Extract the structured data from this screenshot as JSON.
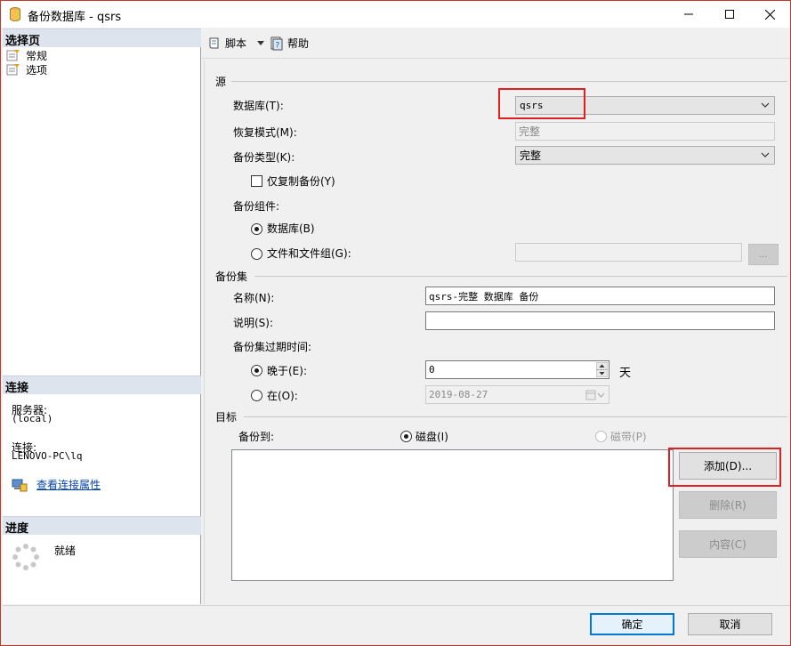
{
  "window": {
    "title": "备份数据库 - qsrs",
    "icon": "database-cylinder-icon",
    "accent_border": "#c0392b"
  },
  "left": {
    "select_page_header": "选择页",
    "pages": [
      {
        "label": "常规",
        "icon": "page-icon"
      },
      {
        "label": "选项",
        "icon": "page-icon"
      }
    ],
    "connection_header": "连接",
    "server_label": "服务器:",
    "server_value": "(local)",
    "connection_label": "连接:",
    "connection_value": "LENOVO-PC\\lq",
    "view_conn_props": "查看连接属性",
    "progress_header": "进度",
    "progress_status": "就绪"
  },
  "toolbar": {
    "script_label": "脚本",
    "help_label": "帮助"
  },
  "source": {
    "group_title": "源",
    "database_label": "数据库(T):",
    "database_value": "qsrs",
    "recovery_label": "恢复模式(M):",
    "recovery_value": "完整",
    "backup_type_label": "备份类型(K):",
    "backup_type_value": "完整",
    "copy_only_label": "仅复制备份(Y)",
    "component_label": "备份组件:",
    "component_db_label": "数据库(B)",
    "component_files_label": "文件和文件组(G):",
    "browse_label": "..."
  },
  "backup_set": {
    "group_title": "备份集",
    "name_label": "名称(N):",
    "name_value": "qsrs-完整 数据库 备份",
    "desc_label": "说明(S):",
    "desc_value": "",
    "expire_label": "备份集过期时间:",
    "after_label": "晚于(E):",
    "after_value": "0",
    "after_unit": "天",
    "on_label": "在(O):",
    "on_value": "2019-08-27"
  },
  "destination": {
    "group_title": "目标",
    "backup_to_label": "备份到:",
    "disk_label": "磁盘(I)",
    "tape_label": "磁带(P)",
    "add_label": "添加(D)...",
    "remove_label": "删除(R)",
    "contents_label": "内容(C)"
  },
  "footer": {
    "ok_label": "确定",
    "cancel_label": "取消"
  }
}
